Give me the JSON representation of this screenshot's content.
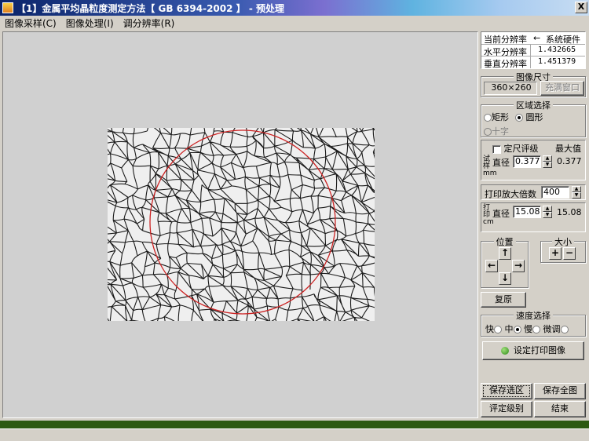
{
  "window": {
    "title": "【1】金属平均晶粒度测定方法【 GB 6394-2002 】 - 预处理",
    "close_label": "X"
  },
  "menu": {
    "items": [
      "图像采样(C)",
      "图像处理(I)",
      "调分辨率(R)"
    ]
  },
  "resolution": {
    "current_label": "当前分辨率",
    "arrow": "←",
    "source": "系统硬件",
    "horizontal_label": "水平分辨率",
    "horizontal_value": "1.432665",
    "vertical_label": "垂直分辨率",
    "vertical_value": "1.451379"
  },
  "image_size": {
    "title": "图像尺寸",
    "value": "360×260",
    "fill_button": "充满窗口"
  },
  "region": {
    "title": "区域选择",
    "rect_label": "矩形",
    "circle_label": "圆形",
    "cross_label": "十字",
    "selected": "circle"
  },
  "sample": {
    "fixed_label": "定尺评级",
    "max_label": "最大值",
    "side_label": "试样mm",
    "diameter_label": "直径",
    "diameter_value": "0.377",
    "max_value": "0.377"
  },
  "print": {
    "magnify_label": "打印放大倍数",
    "magnify_value": "400",
    "side_label": "打印cm",
    "diameter_label": "直径",
    "diameter_value": "15.08",
    "max_value": "15.08"
  },
  "position": {
    "title": "位置",
    "size_title": "大小",
    "up": "↑",
    "down": "↓",
    "left": "←",
    "right": "→",
    "plus": "+",
    "minus": "−",
    "reset_button": "复原"
  },
  "speed": {
    "title": "速度选择",
    "fast": "快",
    "medium": "中",
    "slow": "慢",
    "fine": "微调",
    "selected": "slow"
  },
  "actions": {
    "set_print_image": "设定打印图像",
    "save_selection": "保存选区",
    "save_full": "保存全图",
    "rate_level": "评定级别",
    "finish": "结束"
  },
  "colors": {
    "selection_circle": "#cc2222",
    "status_green": "#2c5a12"
  }
}
